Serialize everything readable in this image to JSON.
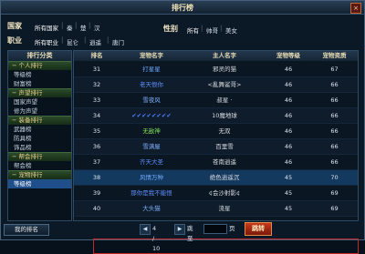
{
  "window": {
    "title": "排行榜",
    "close_label": "×"
  },
  "filters": {
    "country_label": "国家",
    "countries": [
      "所有国家",
      "秦",
      "楚",
      "汉"
    ],
    "gender_label": "性别",
    "genders": [
      "所有",
      "帅哥",
      "美女"
    ],
    "job_label": "职业",
    "jobs": [
      "所有职业",
      "昆仑",
      "逍遥",
      "唐门"
    ]
  },
  "sidebar": {
    "header": "排行分类",
    "groups": [
      {
        "title": "个人排行",
        "items": [
          "等级榜",
          "财富榜"
        ]
      },
      {
        "title": "声望排行",
        "items": [
          "国家声望",
          "修为声望"
        ]
      },
      {
        "title": "装备排行",
        "items": [
          "武器榜",
          "防具榜",
          "饰品榜"
        ]
      },
      {
        "title": "帮会排行",
        "items": [
          "帮会榜"
        ]
      },
      {
        "title": "宠物排行",
        "items": [
          "等级榜"
        ]
      }
    ]
  },
  "table": {
    "headers": [
      "排名",
      "宠物名字",
      "主人名字",
      "宠物等级",
      "宠物资质"
    ],
    "rows": [
      {
        "rank": "31",
        "pet": "打星星",
        "pet_color": "#6fa8ff",
        "owner": "邪灵的猫",
        "level": "46",
        "score": "67"
      },
      {
        "rank": "32",
        "pet": "老天恨你",
        "pet_color": "#5f8fff",
        "owner": "<亂舞鲨哥>",
        "level": "46",
        "score": "66"
      },
      {
        "rank": "33",
        "pet": "雪夜风",
        "pet_color": "#7fb0ff",
        "owner": "叔星 ·",
        "level": "46",
        "score": "66"
      },
      {
        "rank": "34",
        "pet": "✔✔✔✔✔✔✔✔",
        "pet_color": "#4d7dff",
        "owner": "10魔地球",
        "level": "46",
        "score": "66"
      },
      {
        "rank": "35",
        "pet": "无敌神",
        "pet_color": "#7ee05a",
        "owner": "无双",
        "level": "46",
        "score": "66"
      },
      {
        "rank": "36",
        "pet": "雪满屋",
        "pet_color": "#7fb0ff",
        "owner": "百里雪",
        "level": "46",
        "score": "66"
      },
      {
        "rank": "37",
        "pet": "齐天大圣",
        "pet_color": "#5f8fff",
        "owner": "苍南逍遥",
        "level": "46",
        "score": "66"
      },
      {
        "rank": "38",
        "pet": "风情万种",
        "pet_color": "#6fa8ff",
        "owner": "绝色逍遥沉",
        "level": "45",
        "score": "70"
      },
      {
        "rank": "39",
        "pet": "那你是我不能恨",
        "pet_color": "#5f8fff",
        "owner": "¢会沙射影¢",
        "level": "45",
        "score": "69"
      },
      {
        "rank": "40",
        "pet": "大头猫",
        "pet_color": "#7fb0ff",
        "owner": "流星",
        "level": "45",
        "score": "69"
      }
    ]
  },
  "pager": {
    "first_icon": "«",
    "prev_icon": "◀",
    "next_icon": "▶",
    "page": "4",
    "total": "10",
    "page_text": "4 / 10",
    "jump_label": "跳至",
    "page_unit": "页",
    "input_value": ""
  },
  "buttons": {
    "mine": "我的排名",
    "jump": "跳转"
  }
}
